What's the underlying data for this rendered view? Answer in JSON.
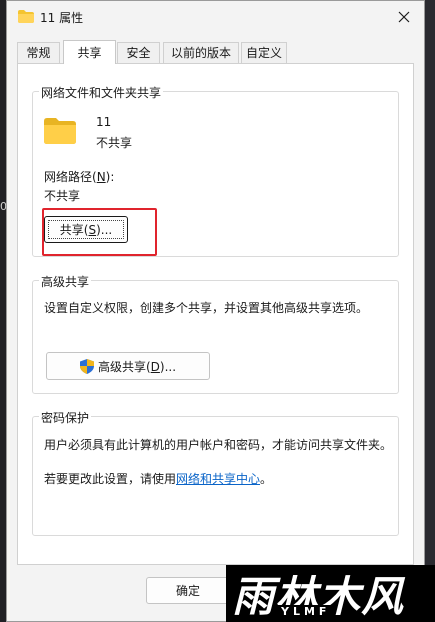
{
  "window": {
    "title": "11 属性"
  },
  "tabs": [
    {
      "label": "常规"
    },
    {
      "label": "共享"
    },
    {
      "label": "安全"
    },
    {
      "label": "以前的版本"
    },
    {
      "label": "自定义"
    }
  ],
  "network_share": {
    "legend": "网络文件和文件夹共享",
    "folder_name": "11",
    "share_state": "不共享",
    "path_label_pre": "网络路径(",
    "path_label_key": "N",
    "path_label_post": "):",
    "path_value": "不共享",
    "share_btn_pre": "共享(",
    "share_btn_key": "S",
    "share_btn_post": ")..."
  },
  "advanced_share": {
    "legend": "高级共享",
    "description": "设置自定义权限，创建多个共享，并设置其他高级共享选项。",
    "btn_pre": "高级共享(",
    "btn_key": "D",
    "btn_post": ")..."
  },
  "password_protect": {
    "legend": "密码保护",
    "line1": "用户必须具有此计算机的用户帐户和密码，才能访问共享文件夹。",
    "line2_pre": "若要更改此设置，请使用",
    "line2_link": "网络和共享中心",
    "line2_post": "。"
  },
  "footer": {
    "ok_label": "确定"
  },
  "watermark": {
    "text_cn": "雨林木风",
    "text_en": "YLMF"
  },
  "desktop": {
    "left_glyph": "0"
  },
  "colors": {
    "annotation": "#e0242d",
    "link": "#0a64c8",
    "folder": "#f4c430"
  }
}
